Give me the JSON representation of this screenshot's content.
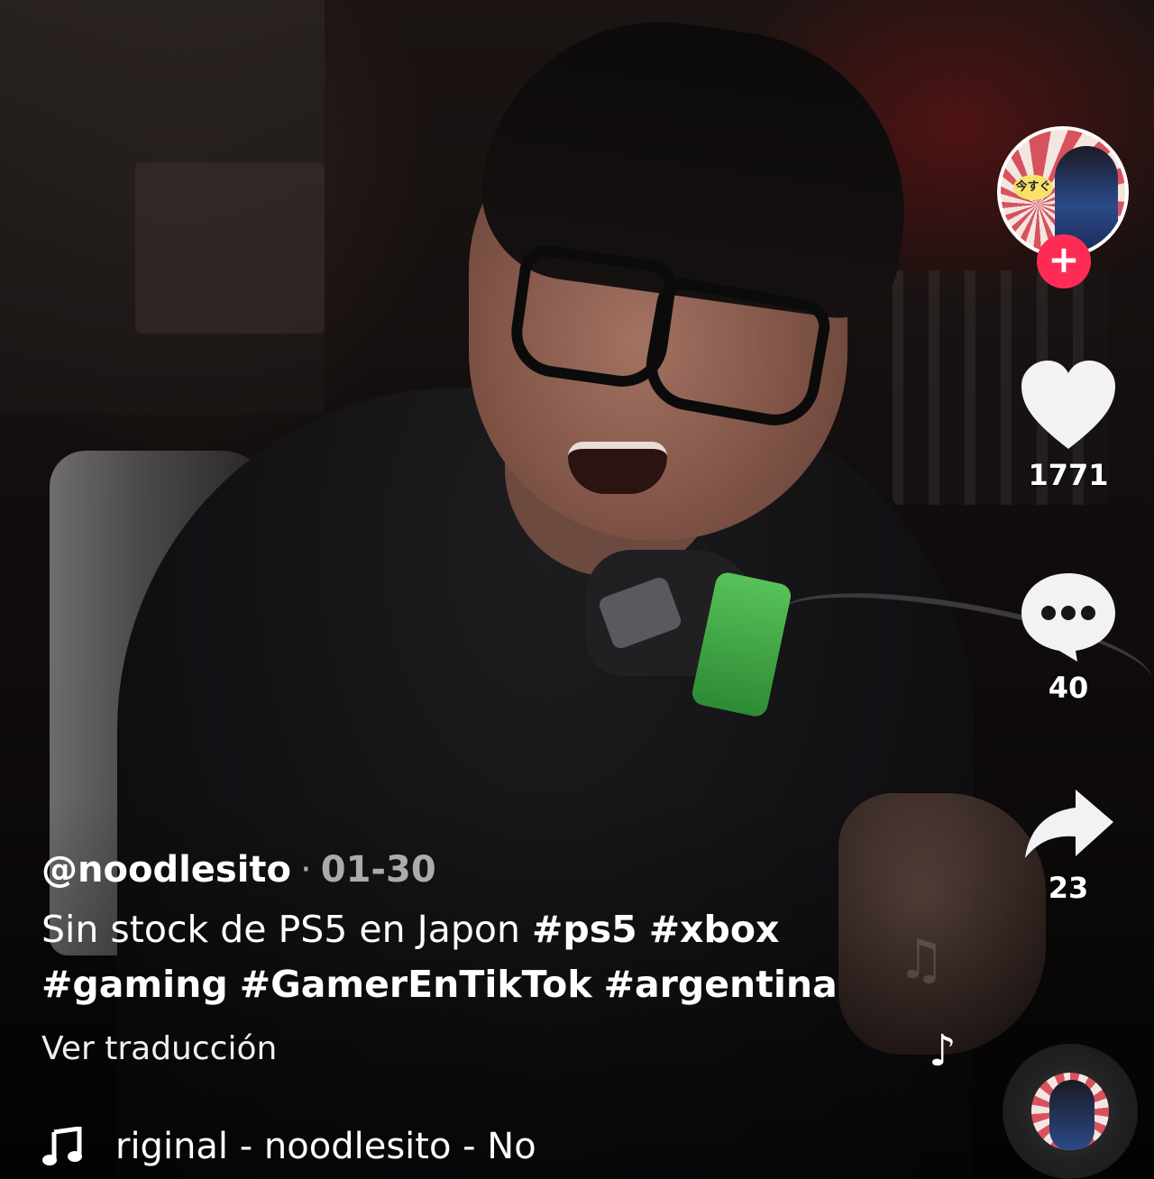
{
  "author": {
    "handle": "@noodlesito",
    "separator": "·",
    "date": "01-30"
  },
  "description": {
    "text": "Sin stock de PS5 en Japon ",
    "hashtags": [
      "#ps5",
      "#xbox",
      "#gaming",
      "#GamerEnTikTok",
      "#argentina"
    ]
  },
  "translate_label": "Ver traducción",
  "music": {
    "text": "riginal - noodlesito - No",
    "icon": "music-note-icon"
  },
  "actions": {
    "like": {
      "count": "1771",
      "icon": "heart-icon"
    },
    "comment": {
      "count": "40",
      "icon": "comment-bubble-icon"
    },
    "share": {
      "count": "23",
      "icon": "share-arrow-icon"
    }
  },
  "avatar": {
    "bubble_text": "今すぐ",
    "follow_label": "+"
  },
  "colors": {
    "follow_button": "#fe2c55",
    "text": "#ffffff"
  }
}
